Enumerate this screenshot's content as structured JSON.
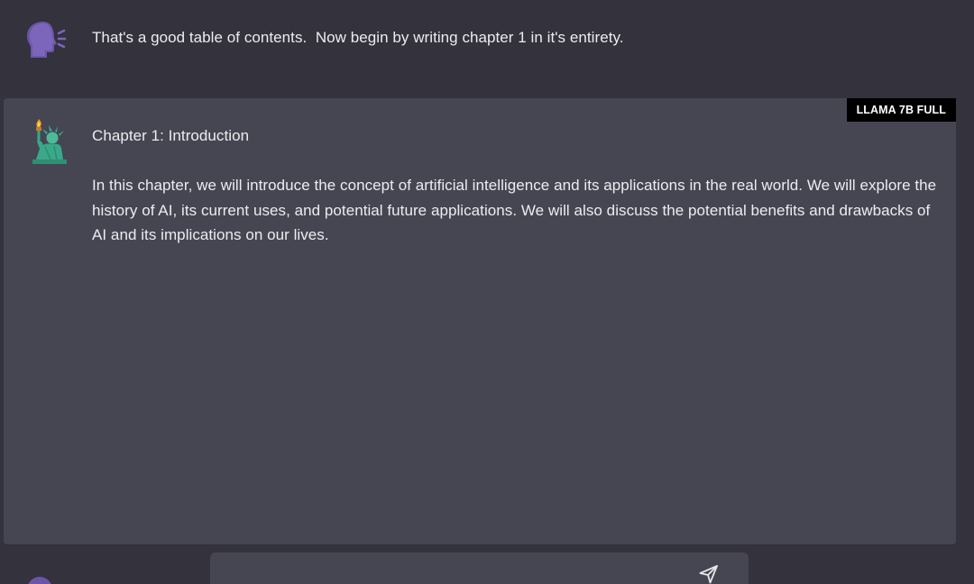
{
  "conversation": {
    "user_message": {
      "avatar_icon": "speaking-head-icon",
      "text": "That's a good table of contents.  Now begin by writing chapter 1 in it's entirety."
    },
    "assistant_message": {
      "avatar_icon": "statue-of-liberty-icon",
      "model_badge": "LLAMA 7B FULL",
      "title": "Chapter 1: Introduction",
      "body": "In this chapter, we will introduce the concept of artificial intelligence and its applications in the real world. We will explore the history of AI, its current uses, and potential future applications. We will also discuss the potential benefits and drawbacks of AI and its implications on our lives."
    }
  },
  "composer": {
    "input_value": "",
    "send_icon": "paper-plane-icon"
  },
  "colors": {
    "background": "#33323d",
    "card": "#464653",
    "badge": "#000000",
    "user_avatar": "#7a63b8",
    "liberty_green": "#3aa889"
  }
}
